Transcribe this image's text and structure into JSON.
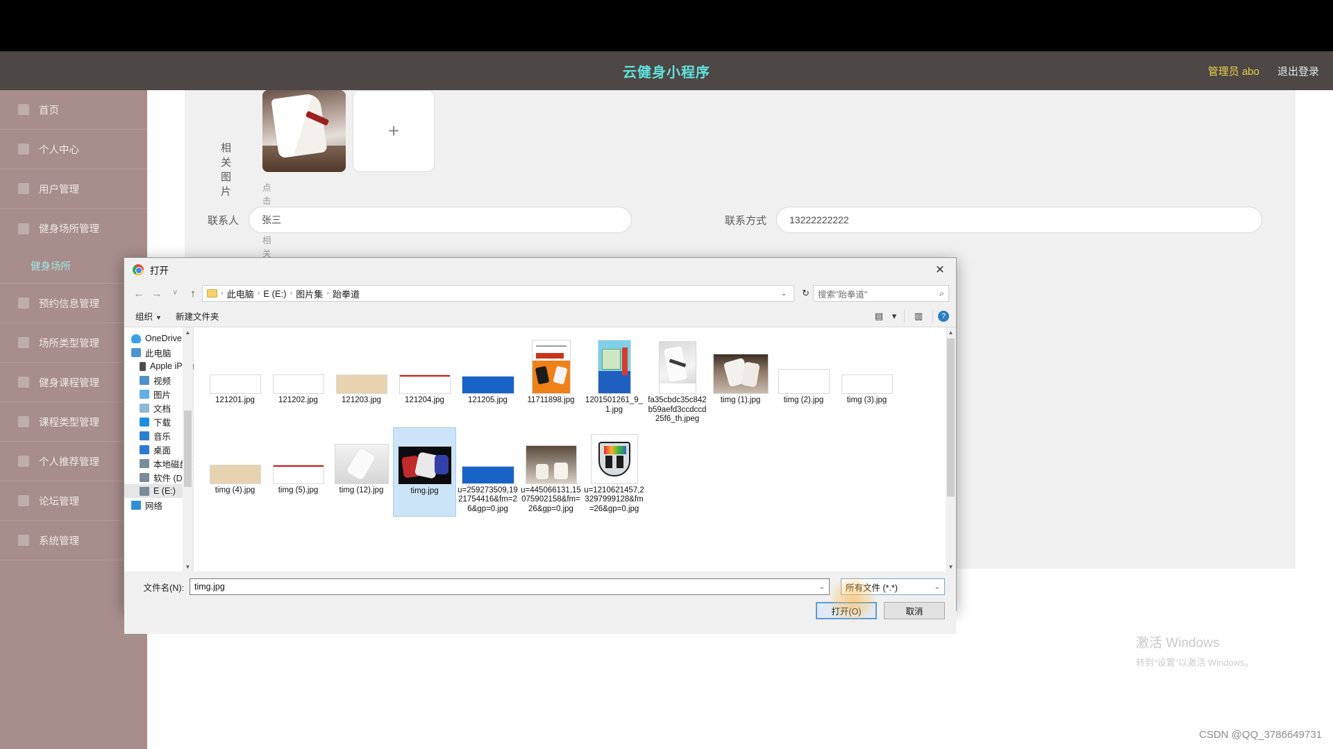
{
  "header": {
    "title": "云健身小程序",
    "user": "管理员 abo",
    "logout": "退出登录"
  },
  "sidebar": {
    "items": [
      {
        "label": "首页",
        "icon": "home-icon"
      },
      {
        "label": "个人中心",
        "icon": "user-icon"
      },
      {
        "label": "用户管理",
        "icon": "users-icon"
      },
      {
        "label": "健身场所管理",
        "icon": "location-icon"
      }
    ],
    "active_sub": "健身场所",
    "items2": [
      {
        "label": "预约信息管理",
        "icon": "calendar-icon"
      },
      {
        "label": "场所类型管理",
        "icon": "tag-icon"
      },
      {
        "label": "健身课程管理",
        "icon": "book-icon"
      },
      {
        "label": "课程类型管理",
        "icon": "list-icon"
      },
      {
        "label": "个人推荐管理",
        "icon": "chart-icon"
      },
      {
        "label": "论坛管理",
        "icon": "forum-icon"
      },
      {
        "label": "系统管理",
        "icon": "gear-icon"
      }
    ]
  },
  "form": {
    "image_label": "相关图片",
    "upload_hint": "点击上传相关图片",
    "plus": "+",
    "contact_label": "联系人",
    "contact_value": "张三",
    "phone_label": "联系方式",
    "phone_value": "13222222222"
  },
  "watermark": {
    "activate_title": "激活 Windows",
    "activate_sub": "转到\"设置\"以激活 Windows。",
    "csdn": "CSDN @QQ_3786649731"
  },
  "dialog": {
    "title": "打开",
    "close": "✕",
    "nav": {
      "back": "←",
      "forward": "→",
      "recent": "ᵛ",
      "up": "↑"
    },
    "breadcrumb": [
      "此电脑",
      "E (E:)",
      "图片集",
      "跆拳道"
    ],
    "crumb_sep": "›",
    "refresh": "↻",
    "search_placeholder": "搜索\"跆拳道\"",
    "search_icon": "⌕",
    "toolbar": {
      "organize": "组织",
      "new_folder": "新建文件夹",
      "view_icon": "▤",
      "pane_icon": "▥",
      "help": "?"
    },
    "tree": [
      {
        "label": "OneDrive",
        "icon": "cloud-icon",
        "indent": false,
        "kind": "cloud"
      },
      {
        "label": "此电脑",
        "icon": "pc-icon",
        "indent": false,
        "kind": "pc"
      },
      {
        "label": "Apple iPhone",
        "icon": "phone-icon",
        "indent": true,
        "kind": "phone"
      },
      {
        "label": "视频",
        "icon": "video-icon",
        "indent": true,
        "kind": "video"
      },
      {
        "label": "图片",
        "icon": "picture-icon",
        "indent": true,
        "kind": "pics"
      },
      {
        "label": "文档",
        "icon": "document-icon",
        "indent": true,
        "kind": "docs"
      },
      {
        "label": "下载",
        "icon": "download-icon",
        "indent": true,
        "kind": "dl"
      },
      {
        "label": "音乐",
        "icon": "music-icon",
        "indent": true,
        "kind": "music"
      },
      {
        "label": "桌面",
        "icon": "desktop-icon",
        "indent": true,
        "kind": "desk"
      },
      {
        "label": "本地磁盘 (C:)",
        "icon": "disk-icon",
        "indent": true,
        "kind": "disk"
      },
      {
        "label": "软件 (D:)",
        "icon": "disk-icon",
        "indent": true,
        "kind": "disk"
      },
      {
        "label": "E (E:)",
        "icon": "disk-icon",
        "indent": true,
        "kind": "disk",
        "selected": true
      },
      {
        "label": "网络",
        "icon": "network-icon",
        "indent": false,
        "kind": "net"
      }
    ],
    "files": [
      {
        "name": "121201.jpg",
        "art": "calig"
      },
      {
        "name": "121202.jpg",
        "art": "calig2"
      },
      {
        "name": "121203.jpg",
        "art": "tan"
      },
      {
        "name": "121204.jpg",
        "art": "red"
      },
      {
        "name": "121205.jpg",
        "art": "blue"
      },
      {
        "name": "11711898.jpg",
        "art": "book"
      },
      {
        "name": "1201501261_9_1.jpg",
        "art": "book2"
      },
      {
        "name": "fa35cbdc35c842b59aefd3ccdccd25f6_th.jpeg",
        "art": "photo"
      },
      {
        "name": "timg (1).jpg",
        "art": "dark"
      },
      {
        "name": "timg (2).jpg",
        "art": "calig"
      },
      {
        "name": "timg (3).jpg",
        "art": "calig2"
      },
      {
        "name": "timg (4).jpg",
        "art": "tan"
      },
      {
        "name": "timg (5).jpg",
        "art": "red"
      },
      {
        "name": "timg (12).jpg",
        "art": "gray"
      },
      {
        "name": "timg.jpg",
        "art": "fight",
        "selected": true
      },
      {
        "name": "u=259273509,1921754416&fm=26&gp=0.jpg",
        "art": "blue"
      },
      {
        "name": "u=445066131,15075902158&fm=26&gp=0.jpg",
        "art": "kids"
      },
      {
        "name": "u=1210621457,23297999128&fm=26&gp=0.jpg",
        "art": "crest"
      }
    ],
    "footer": {
      "filename_label": "文件名(N):",
      "filename_value": "timg.jpg",
      "filetype_value": "所有文件 (*.*)",
      "open_button": "打开(O)",
      "cancel_button": "取消"
    }
  }
}
